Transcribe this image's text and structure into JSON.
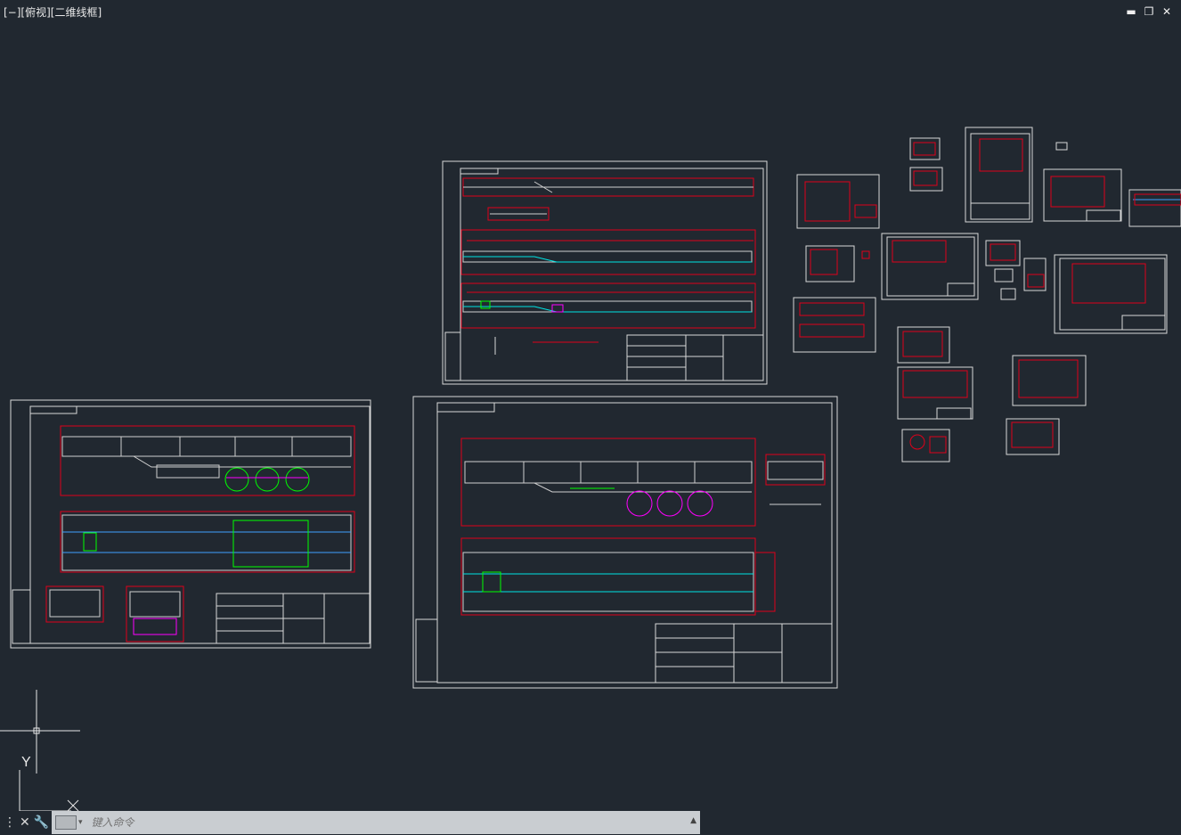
{
  "viewport": {
    "label": "[−][俯视][二维线框]"
  },
  "window_controls": {
    "minimize": "▬",
    "restore": "❐",
    "close": "✕"
  },
  "ucs": {
    "y_label": "Y"
  },
  "command_line": {
    "placeholder": "键入命令",
    "close": "✕",
    "settings": "🔧",
    "history": "▲"
  },
  "colors": {
    "background": "#212830",
    "sheet": "#d8d8d8",
    "dim": "#e0001a",
    "accent_cyan": "#00e5e5",
    "accent_green": "#00ff00",
    "accent_magenta": "#ff00ff"
  },
  "icons": [
    "minimize-icon",
    "restore-icon",
    "close-icon",
    "wrench-icon",
    "command-prompt-icon"
  ]
}
